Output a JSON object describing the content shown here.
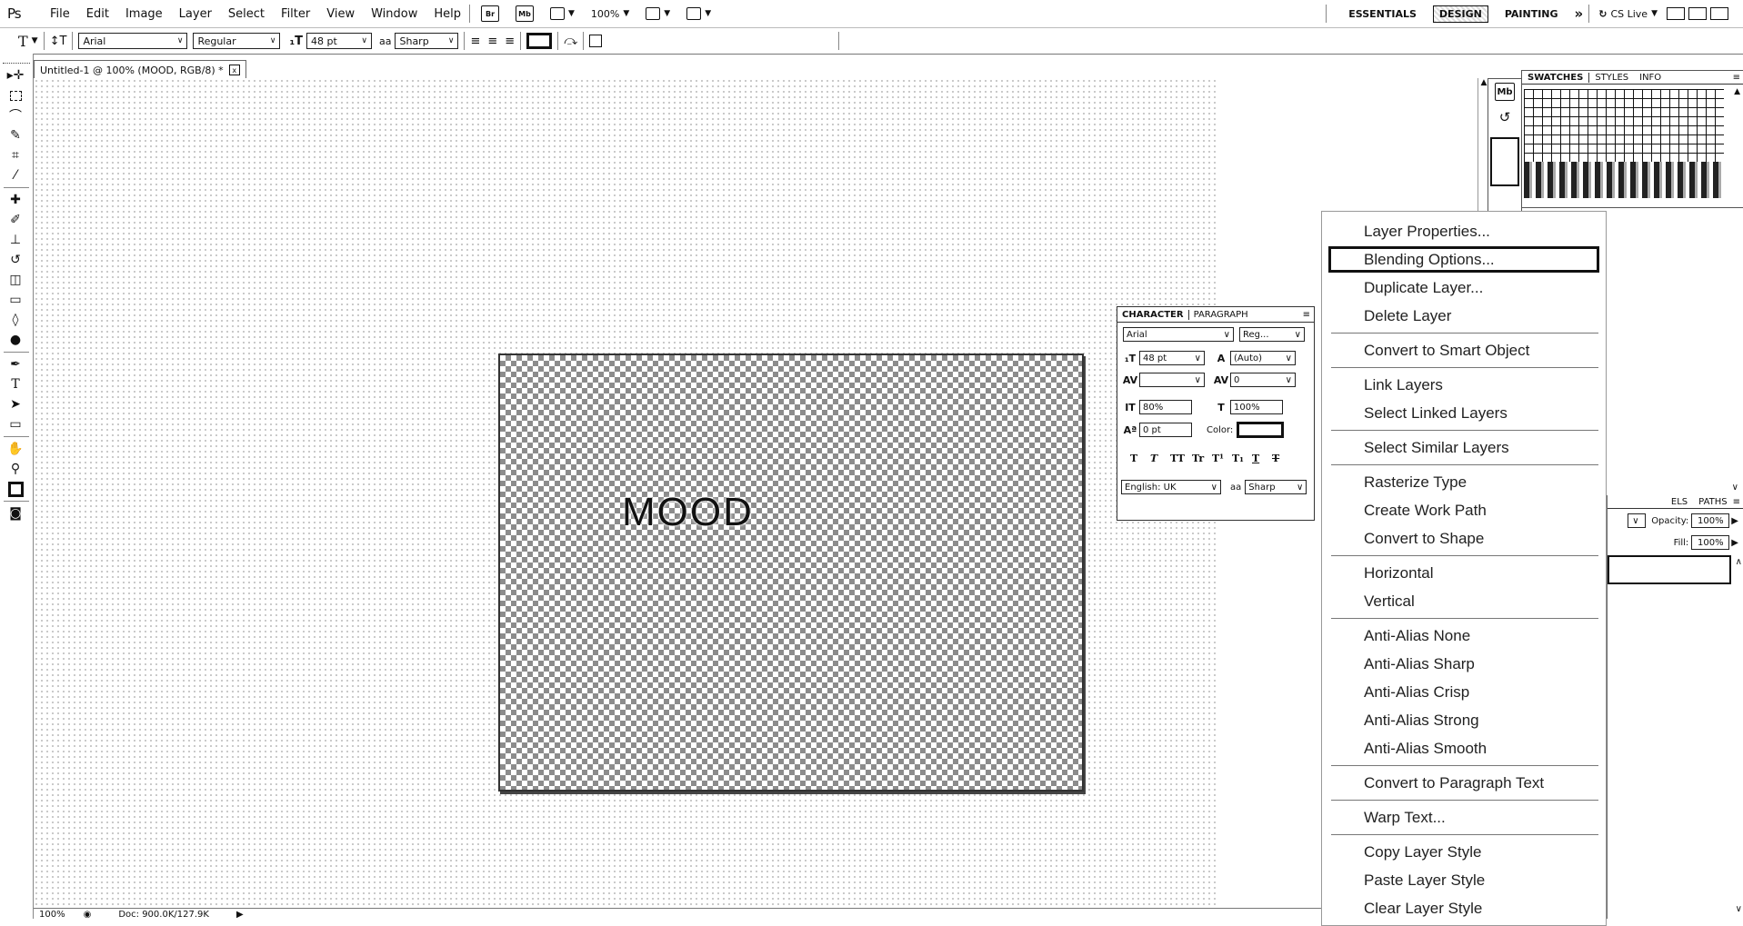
{
  "app": {
    "logo": "Ps",
    "menus": [
      "File",
      "Edit",
      "Image",
      "Layer",
      "Select",
      "Filter",
      "View",
      "Window",
      "Help"
    ],
    "menubar_buttons": {
      "bridge": "Br",
      "minibridge": "Mb",
      "zoom": "100%"
    },
    "workspaces": [
      "ESSENTIALS",
      "DESIGN",
      "PAINTING"
    ],
    "workspace_more": "»",
    "cslive": "CS Live"
  },
  "options_bar": {
    "tool_glyph": "T",
    "font_family": "Arial",
    "font_style": "Regular",
    "font_size": "48 pt",
    "antialias_icon": "aa",
    "antialias": "Sharp"
  },
  "document": {
    "tab_title": "Untitled-1 @ 100% (MOOD, RGB/8) *",
    "close": "x",
    "canvas_text": "MOOD",
    "status_zoom": "100%",
    "status_doc": "Doc: 900.0K/127.9K",
    "status_arrow": "▶"
  },
  "character_panel": {
    "tabs": [
      "CHARACTER",
      "PARAGRAPH"
    ],
    "font_family": "Arial",
    "font_style": "Reg...",
    "font_size": "48 pt",
    "leading": "(Auto)",
    "kerning": "",
    "tracking": "0",
    "vertical_scale": "80%",
    "horizontal_scale": "100%",
    "baseline_shift": "0 pt",
    "color_label": "Color:",
    "style_buttons": [
      "T",
      "T",
      "TT",
      "Tr",
      "T¹",
      "T₁",
      "T",
      "T"
    ],
    "language": "English: UK",
    "antialias_icon": "aa",
    "antialias": "Sharp"
  },
  "right_dock": {
    "icon_strip": [
      "Mb",
      "History"
    ],
    "swatches_tabs": [
      "SWATCHES",
      "STYLES",
      "INFO"
    ],
    "layers_tabs": [
      "ELS",
      "PATHS"
    ],
    "opacity_label": "Opacity:",
    "opacity_value": "100%",
    "fill_label": "Fill:",
    "fill_value": "100%"
  },
  "context_menu": {
    "groups": [
      [
        "Layer Properties...",
        "Blending Options..."
      ],
      [
        "Duplicate Layer...",
        "Delete Layer"
      ],
      [
        "Convert to Smart Object"
      ],
      [
        "Link Layers",
        "Select Linked Layers"
      ],
      [
        "Select Similar Layers"
      ],
      [
        "Rasterize Type",
        "Create Work Path",
        "Convert to Shape"
      ],
      [
        "Horizontal",
        "Vertical"
      ],
      [
        "Anti-Alias None",
        "Anti-Alias Sharp",
        "Anti-Alias Crisp",
        "Anti-Alias Strong",
        "Anti-Alias Smooth"
      ],
      [
        "Convert to Paragraph Text"
      ],
      [
        "Warp Text..."
      ],
      [
        "Copy Layer Style",
        "Paste Layer Style",
        "Clear Layer Style"
      ]
    ],
    "highlighted": "Blending Options..."
  }
}
